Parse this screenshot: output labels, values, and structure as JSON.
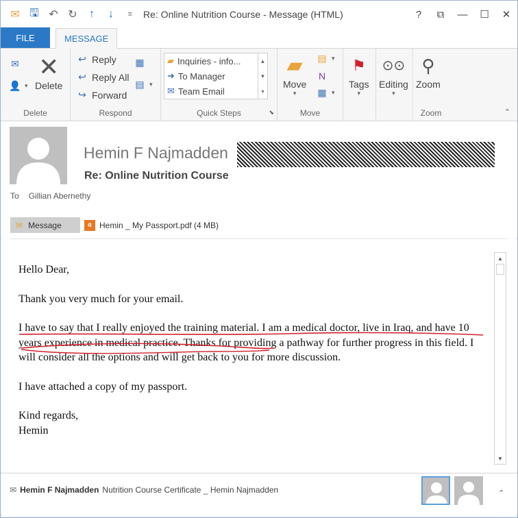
{
  "window": {
    "title": "Re: Online Nutrition Course - Message (HTML)",
    "help": "?",
    "minimize": "—",
    "maximize": "☐",
    "close": "✕",
    "restore": "⧉"
  },
  "tabs": [
    {
      "label": "FILE"
    },
    {
      "label": "MESSAGE"
    }
  ],
  "ribbon": {
    "delete_group": {
      "label": "Delete",
      "delete_button": "Delete"
    },
    "respond_group": {
      "label": "Respond",
      "reply": "Reply",
      "reply_all": "Reply All",
      "forward": "Forward"
    },
    "quick_steps_group": {
      "label": "Quick Steps",
      "items": [
        "Inquiries - info...",
        "To Manager",
        "Team Email"
      ]
    },
    "move_group": {
      "label": "Move",
      "move_button": "Move"
    },
    "tags_group": {
      "label": "Tags",
      "tags_button": "Tags"
    },
    "editing_group": {
      "label": "Editing",
      "editing_button": "Editing"
    },
    "zoom_group": {
      "label": "Zoom",
      "zoom_button": "Zoom"
    }
  },
  "header": {
    "sender_name": "Hemin F Najmadden",
    "subject": "Re: Online Nutrition Course",
    "to_label": "To",
    "to_value": "Gillian Abernethy",
    "message_chip": "Message",
    "attachment": "Hemin _ My Passport.pdf (4 MB)"
  },
  "body": {
    "greeting": "Hello Dear,",
    "para1": "Thank you very much for your email.",
    "para2": "I have to say that I really enjoyed the training material. I am a medical doctor, live in Iraq, and have 10 years experience in medical practice. Thanks for providing a pathway for further progress in this field. I will consider all the options and will get back to you for more discussion.",
    "para3": "I have attached a copy of my passport.",
    "closing": "Kind regards,",
    "signature": "Hemin"
  },
  "people_pane": {
    "name": "Hemin F Najmadden",
    "item": "Nutrition Course Certificate _ Hemin Najmadden"
  },
  "colors": {
    "accent": "#2b79c6",
    "ink": "#d0202a"
  }
}
